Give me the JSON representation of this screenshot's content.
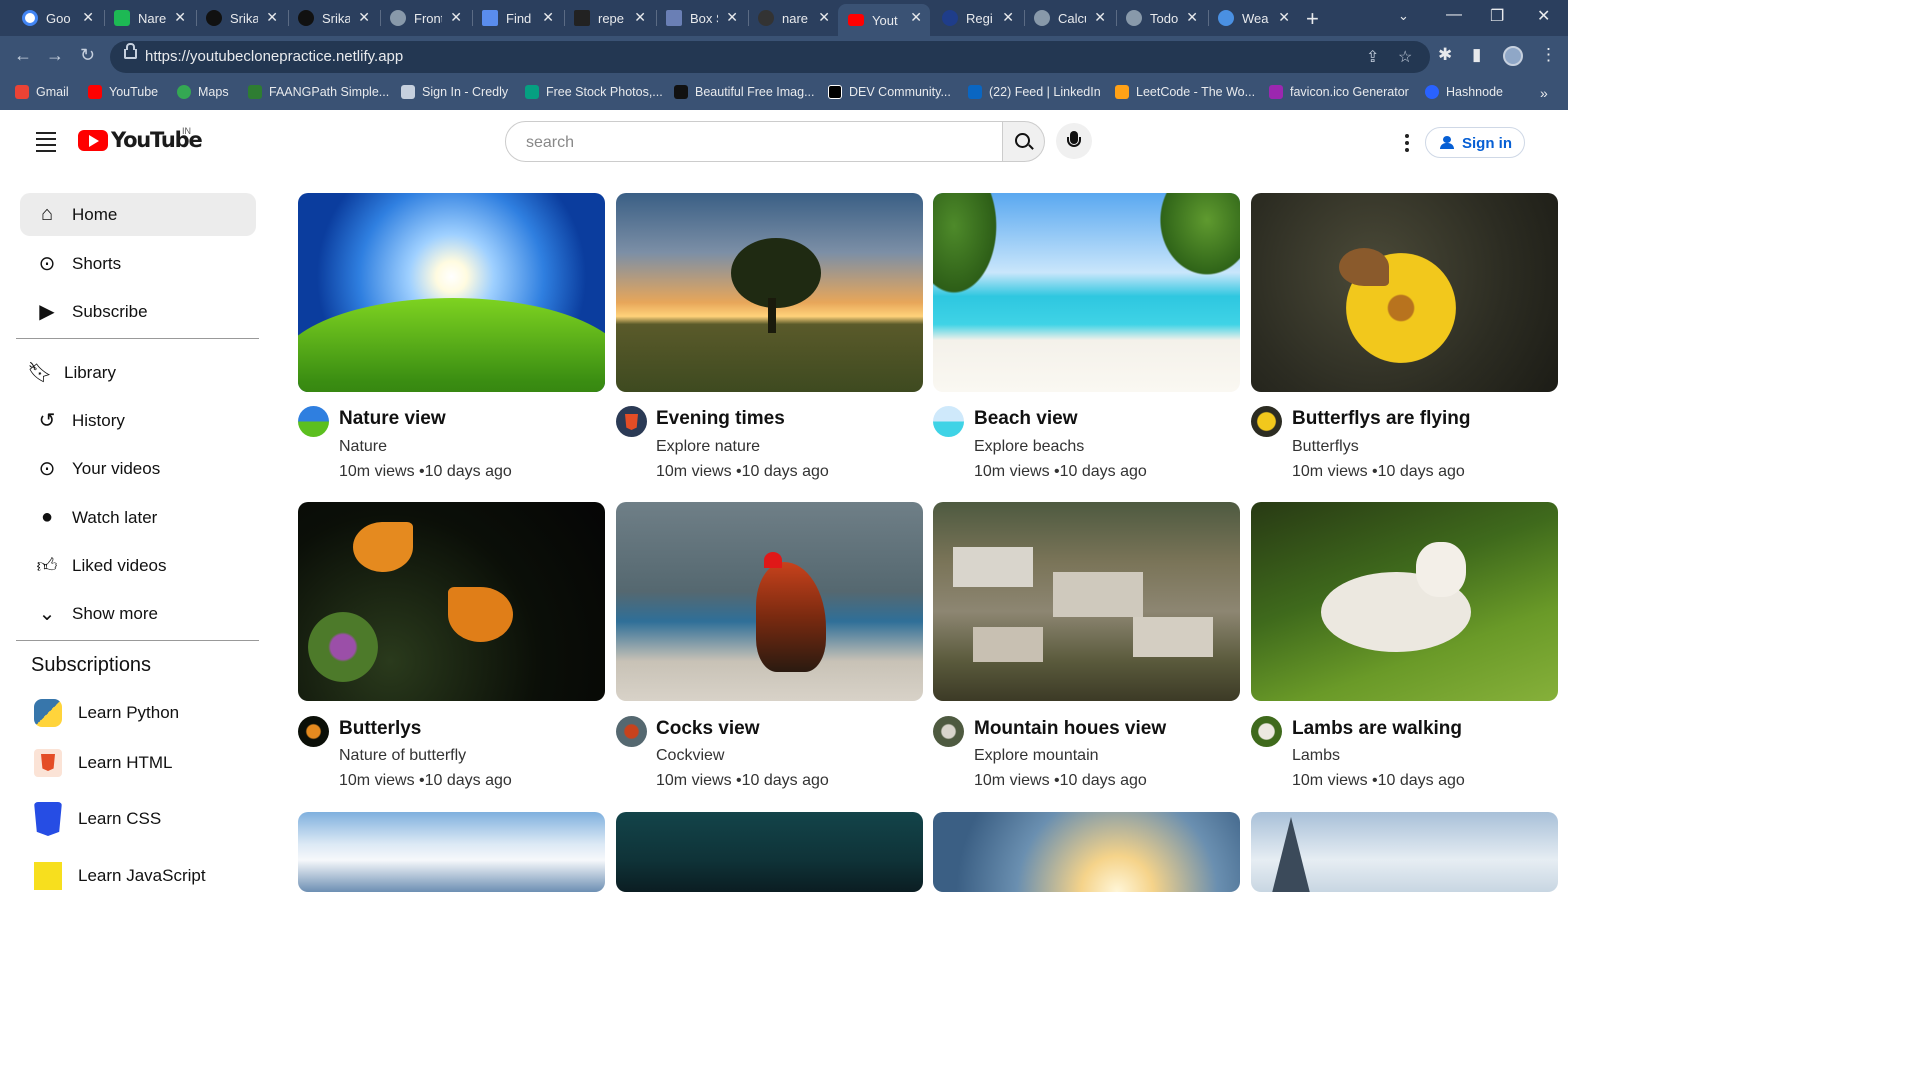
{
  "browser": {
    "tabs": [
      {
        "label": "Goo",
        "color": "#4285f4"
      },
      {
        "label": "Nare",
        "color": "#1db954"
      },
      {
        "label": "Srika",
        "color": "#111111"
      },
      {
        "label": "Srika",
        "color": "#111111"
      },
      {
        "label": "Front",
        "color": "#8899aa"
      },
      {
        "label": "Find",
        "color": "#5a8dee"
      },
      {
        "label": "repe",
        "color": "#222222"
      },
      {
        "label": "Box S",
        "color": "#6a7fb5"
      },
      {
        "label": "nare",
        "color": "#333333"
      },
      {
        "label": "Yout",
        "color": "#ff0000"
      },
      {
        "label": "Regi",
        "color": "#1f3d8a"
      },
      {
        "label": "Calcu",
        "color": "#8899aa"
      },
      {
        "label": "Todo",
        "color": "#8899aa"
      },
      {
        "label": "Wea",
        "color": "#4a90e2"
      }
    ],
    "url": "https://youtubeclonepractice.netlify.app",
    "bookmarks": [
      {
        "label": "Gmail",
        "color": "#ea4335"
      },
      {
        "label": "YouTube",
        "color": "#ff0000"
      },
      {
        "label": "Maps",
        "color": "#34a853"
      },
      {
        "label": "FAANGPath Simple...",
        "color": "#2e7d32"
      },
      {
        "label": "Sign In - Credly",
        "color": "#2b3f5e"
      },
      {
        "label": "Free Stock Photos,...",
        "color": "#05a081"
      },
      {
        "label": "Beautiful Free Imag...",
        "color": "#111111"
      },
      {
        "label": "DEV Community...",
        "color": "#000000"
      },
      {
        "label": "(22) Feed | LinkedIn",
        "color": "#0a66c2"
      },
      {
        "label": "LeetCode - The Wo...",
        "color": "#ffa116"
      },
      {
        "label": "favicon.ico Generator",
        "color": "#9c27b0"
      },
      {
        "label": "Hashnode",
        "color": "#2962ff"
      }
    ]
  },
  "header": {
    "logo_text": "YouTube",
    "country": "IN",
    "search_placeholder": "search",
    "sign_in": "Sign in"
  },
  "sidebar": {
    "main": [
      {
        "label": "Home",
        "icon": "home-icon"
      },
      {
        "label": "Shorts",
        "icon": "shorts-icon"
      },
      {
        "label": "Subscribe",
        "icon": "subscriptions-icon"
      }
    ],
    "library": [
      {
        "label": "Library",
        "icon": "library-icon"
      },
      {
        "label": "History",
        "icon": "history-icon"
      },
      {
        "label": "Your videos",
        "icon": "your-videos-icon"
      },
      {
        "label": "Watch later",
        "icon": "watch-later-icon"
      },
      {
        "label": "Liked videos",
        "icon": "liked-icon"
      },
      {
        "label": "Show more",
        "icon": "chevron-down-icon"
      }
    ],
    "subscriptions_title": "Subscriptions",
    "subscriptions": [
      {
        "label": "Learn Python",
        "icon": "python-icon"
      },
      {
        "label": "Learn HTML",
        "icon": "html-icon"
      },
      {
        "label": "Learn CSS",
        "icon": "css-icon"
      },
      {
        "label": "Learn JavaScript",
        "icon": "javascript-icon"
      }
    ]
  },
  "videos": [
    {
      "title": "Nature view",
      "channel": "Nature",
      "meta": "10m views •10 days ago",
      "thumb": "sunny-meadow"
    },
    {
      "title": "Evening times",
      "channel": "Explore nature",
      "meta": "10m views •10 days ago",
      "thumb": "sunset-tree"
    },
    {
      "title": "Beach view",
      "channel": "Explore beachs",
      "meta": "10m views •10 days ago",
      "thumb": "tropical-beach"
    },
    {
      "title": "Butterflys are flying",
      "channel": "Butterflys",
      "meta": "10m views •10 days ago",
      "thumb": "butterfly-flower"
    },
    {
      "title": "Butterlys",
      "channel": "Nature of butterfly",
      "meta": "10m views •10 days ago",
      "thumb": "butterflies-thistle"
    },
    {
      "title": "Cocks view",
      "channel": "Cockview",
      "meta": "10m views •10 days ago",
      "thumb": "rooster"
    },
    {
      "title": "Mountain houes view",
      "channel": "Explore mountain",
      "meta": "10m views •10 days ago",
      "thumb": "mountain-village"
    },
    {
      "title": "Lambs are walking",
      "channel": "Lambs",
      "meta": "10m views •10 days ago",
      "thumb": "lamb-grass"
    },
    {
      "title": "",
      "channel": "",
      "meta": "",
      "thumb": "snowy-mountain"
    },
    {
      "title": "",
      "channel": "",
      "meta": "",
      "thumb": "night-city"
    },
    {
      "title": "",
      "channel": "",
      "meta": "",
      "thumb": "sunset-sky"
    },
    {
      "title": "",
      "channel": "",
      "meta": "",
      "thumb": "snowy-tree"
    }
  ]
}
